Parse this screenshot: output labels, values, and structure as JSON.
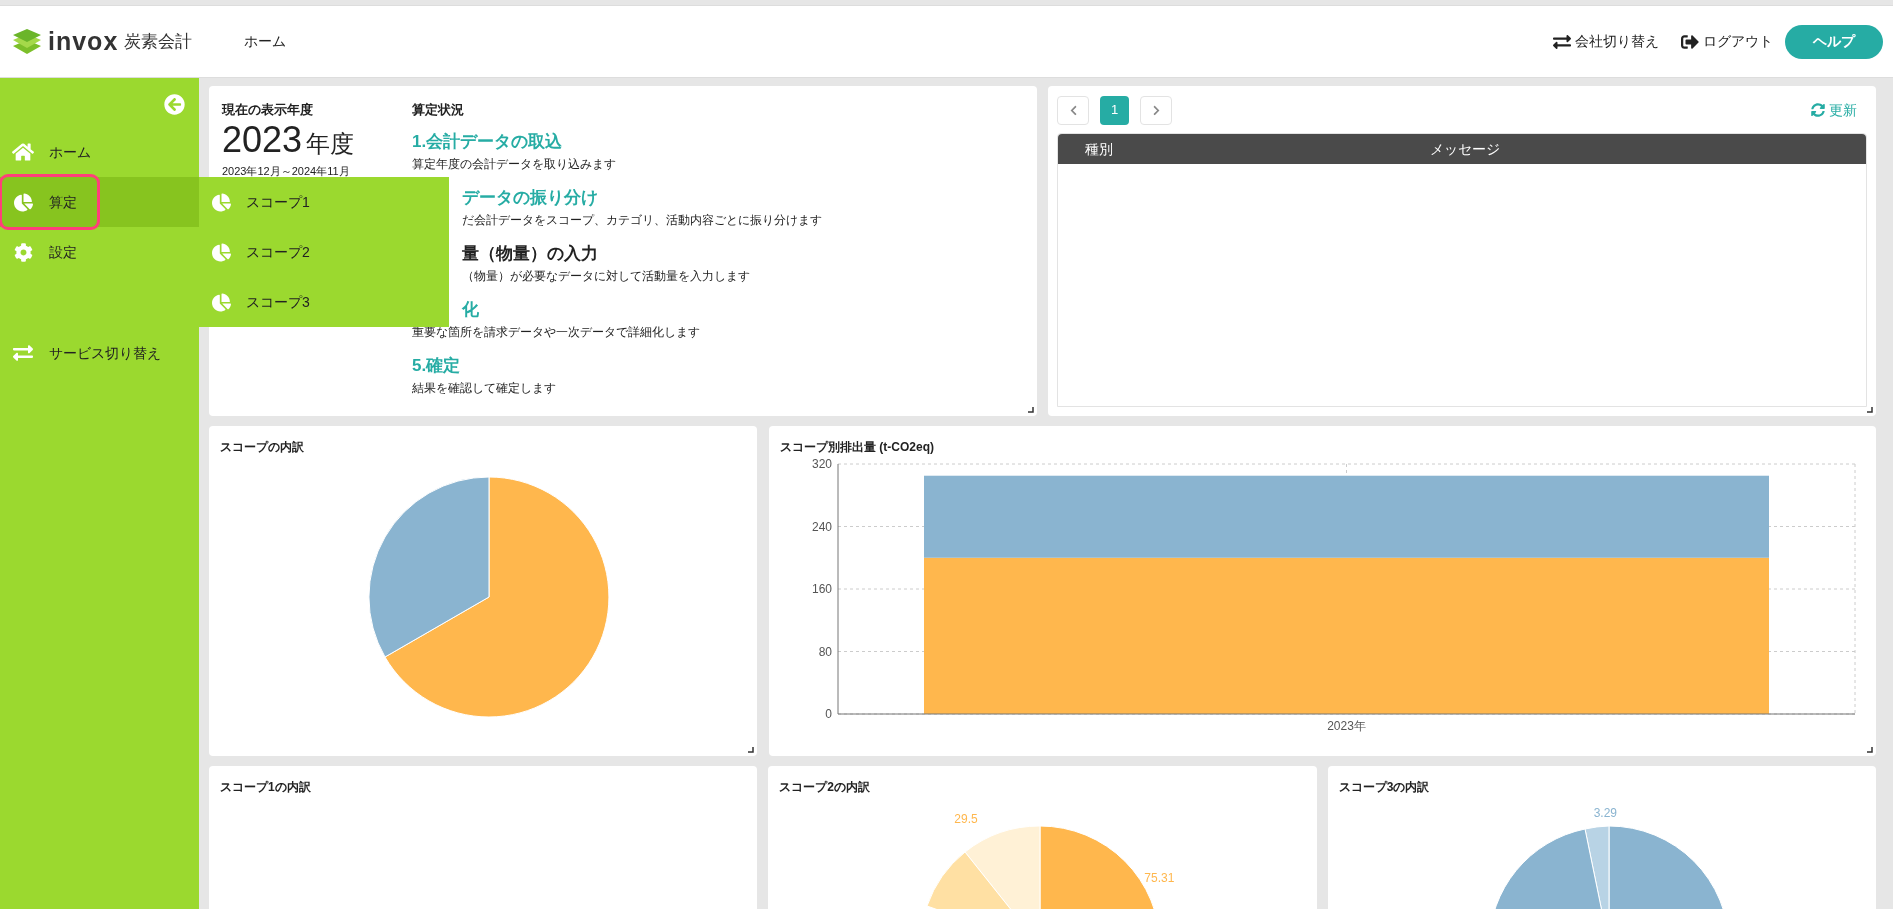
{
  "header": {
    "logo_text": "invox",
    "logo_subtext": "炭素会計",
    "nav": [
      {
        "label": "ホーム"
      }
    ],
    "actions": [
      {
        "kind": "switch",
        "label": "会社切り替え"
      },
      {
        "kind": "logout",
        "label": "ログアウト"
      },
      {
        "kind": "help",
        "label": "ヘルプ"
      }
    ]
  },
  "sidebar": {
    "items": [
      {
        "kind": "home",
        "label": "ホーム",
        "selected": false
      },
      {
        "kind": "calc",
        "label": "算定",
        "selected": true
      },
      {
        "kind": "settings",
        "label": "設定",
        "selected": false
      },
      {
        "kind": "switch",
        "label": "サービス切り替え",
        "selected": false
      }
    ]
  },
  "submenu": {
    "items": [
      {
        "label": "スコープ1"
      },
      {
        "label": "スコープ2"
      },
      {
        "label": "スコープ3"
      }
    ]
  },
  "year_panel": {
    "heading": "現在の表示年度",
    "year": "2023",
    "year_suffix": "年度",
    "period": "2023年12月～2024年11月"
  },
  "status": {
    "heading": "算定状況",
    "steps": [
      {
        "title": "1.会計データの取込",
        "description": "算定年度の会計データを取り込みます",
        "done": true,
        "title_covered": false,
        "description_covered": false
      },
      {
        "title": "データの振り分け",
        "description": "だ会計データをスコープ、カテゴリ、活動内容ごとに振り分けます",
        "done": true,
        "title_covered": true,
        "description_covered": true
      },
      {
        "title": "量（物量）の入力",
        "description": "（物量）が必要なデータに対して活動量を入力します",
        "done": false,
        "title_covered": true,
        "description_covered": true
      },
      {
        "title": "化",
        "description": "重要な箇所を請求データや一次データで詳細化します",
        "done": true,
        "title_covered": true,
        "description_covered": false
      },
      {
        "title": "5.確定",
        "description": "結果を確認して確定します",
        "done": true,
        "title_covered": false,
        "description_covered": false
      }
    ]
  },
  "messages": {
    "pages": [
      {
        "label": "1",
        "selected": true
      }
    ],
    "refresh": "更新",
    "columns": [
      "種別",
      "メッセージ"
    ]
  },
  "scope_breakdown": {
    "title": "スコープの内訳"
  },
  "emissions": {
    "title": "スコープ別排出量 (t-CO2eq)",
    "chart_data": {
      "type": "bar",
      "stacked": true,
      "categories": [
        "2023年"
      ],
      "series": [
        {
          "color": "#ffb74d",
          "values": [
            200
          ]
        },
        {
          "color": "#8ab4d0",
          "values": [
            105
          ]
        }
      ],
      "ylim": [
        0,
        320
      ],
      "yticks": [
        0,
        80,
        160,
        240,
        320
      ],
      "grid": true
    }
  },
  "scope1": {
    "title": "スコープ1の内訳"
  },
  "scope2": {
    "title": "スコープ2の内訳",
    "labels": [
      "29.5",
      "75.31"
    ]
  },
  "scope3": {
    "title": "スコープ3の内訳",
    "labels": [
      "3.29"
    ]
  }
}
